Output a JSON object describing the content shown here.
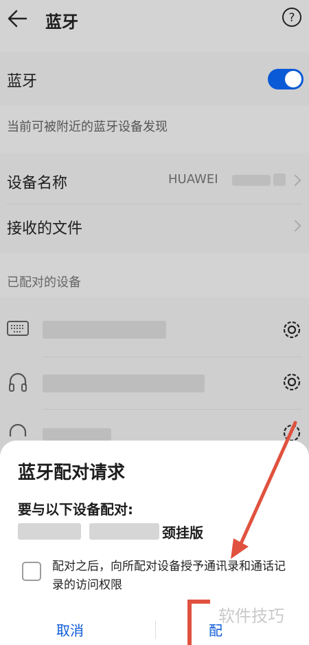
{
  "header": {
    "title": "蓝牙"
  },
  "bluetooth": {
    "label": "蓝牙",
    "enabled": true,
    "discover_text": "当前可被附近的蓝牙设备发现"
  },
  "device": {
    "name_label": "设备名称",
    "name_value": "HUAWEI",
    "files_label": "接收的文件"
  },
  "paired": {
    "title": "已配对的设备"
  },
  "modal": {
    "title": "蓝牙配对请求",
    "subtitle": "要与以下设备配对:",
    "device_suffix": "颈挂版",
    "checkbox_text": "配对之后，向所配对设备授予通讯录和通话记录的访问权限",
    "cancel_label": "取消",
    "confirm_label_partial": "配"
  },
  "watermark": "软件技巧",
  "colors": {
    "accent": "#0a59d6",
    "annotation": "#e0523f"
  }
}
